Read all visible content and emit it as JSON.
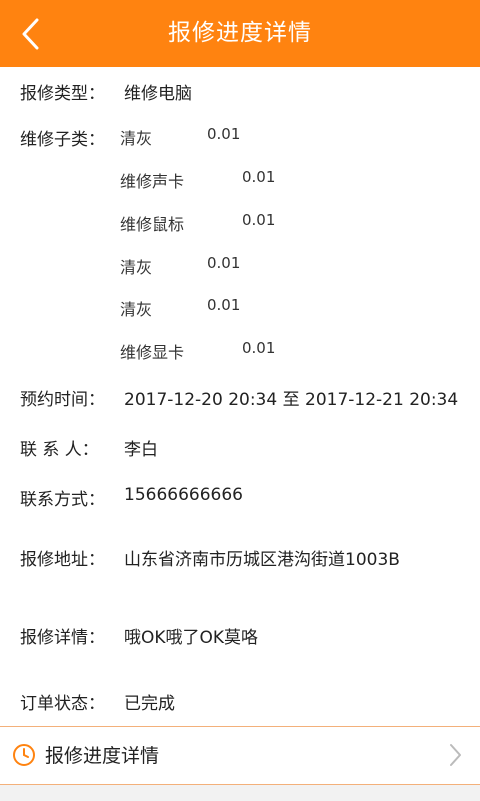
{
  "header": {
    "title": "报修进度详情",
    "back_icon": "chevron-left-icon",
    "color": "#ff8310"
  },
  "details": {
    "type_label": "报修类型：",
    "type_value": "维修电脑",
    "subtype_label": "维修子类：",
    "subtypes": [
      {
        "name": "清灰",
        "price": "0.01"
      },
      {
        "name": "维修声卡",
        "price": "0.01"
      },
      {
        "name": "维修鼠标",
        "price": "0.01"
      },
      {
        "name": "清灰",
        "price": "0.01"
      },
      {
        "name": "清灰",
        "price": "0.01"
      },
      {
        "name": "维修显卡",
        "price": "0.01"
      }
    ],
    "time_label": "预约时间：",
    "time_value": "2017-12-20 20:34 至 2017-12-21 20:34",
    "contact_label": "联 系 人：",
    "contact_value": "李白",
    "phone_label": "联系方式：",
    "phone_value": "15666666666",
    "address_label": "报修地址：",
    "address_value": "山东省济南市历城区港沟街道1003B",
    "detail_label": "报修详情：",
    "detail_value": "哦OK哦了OK莫咯",
    "status_label": "订单状态：",
    "status_value": "已完成"
  },
  "progress": {
    "label": "报修进度详情",
    "icon": "clock-icon",
    "chevron": "chevron-right-icon"
  }
}
